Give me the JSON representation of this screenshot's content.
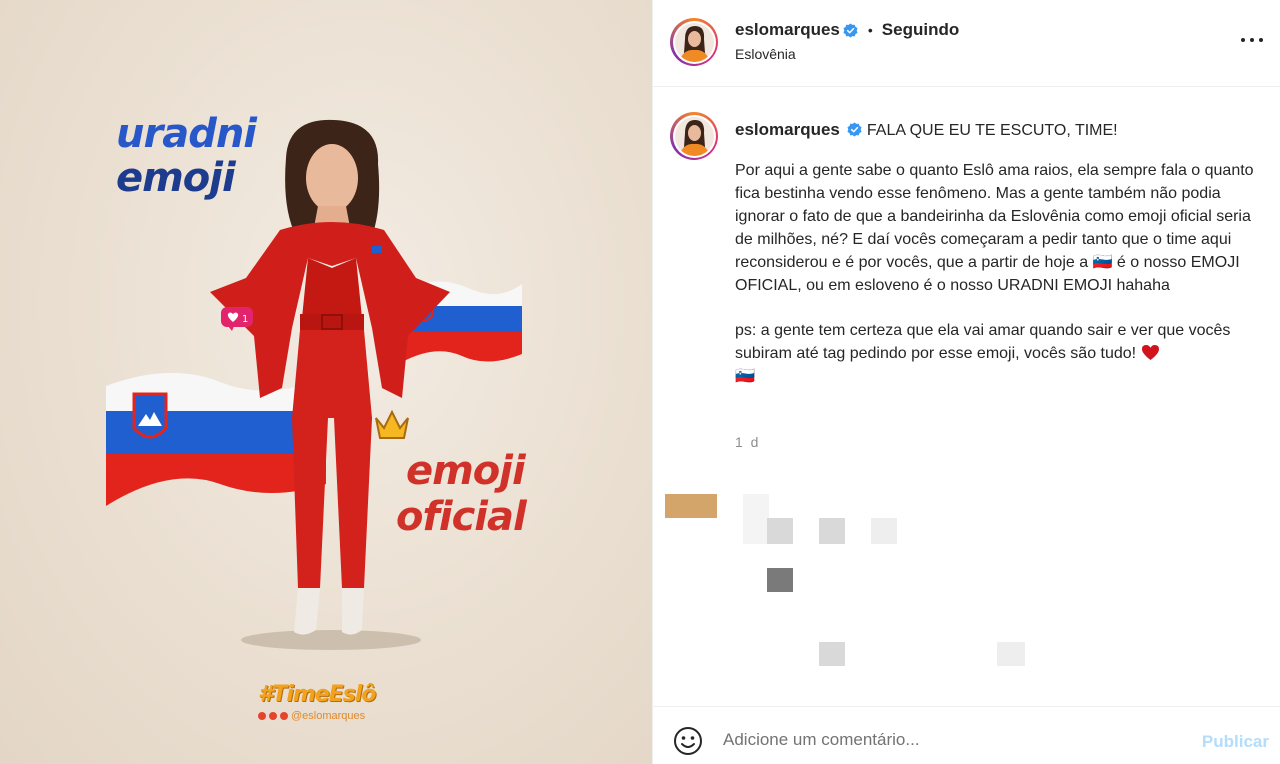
{
  "media": {
    "headline": [
      "uradni",
      "emoji"
    ],
    "official": [
      "emoji",
      "oficial"
    ],
    "hashtag": "#TimeEslô",
    "handle": "@eslomarques"
  },
  "header": {
    "username": "eslomarques",
    "separator": "•",
    "follow_label": "Seguindo",
    "location": "Eslovênia",
    "more_icon": "more-options-icon"
  },
  "caption": {
    "username": "eslomarques",
    "first_line": "FALA QUE EU TE ESCUTO, TIME!",
    "paragraph1": "Por aqui a gente sabe o quanto Eslô ama raios, ela sempre fala o quanto fica bestinha vendo esse fenômeno. Mas a gente também não podia ignorar o fato de que a bandeirinha da Eslovênia como emoji oficial seria de milhões, né? E daí vocês começaram a pedir tanto que o time aqui reconsiderou e é por vocês, que a partir de hoje a 🇸🇮 é o nosso EMOJI OFICIAL, ou em esloveno é o nosso URADNI EMOJI hahaha",
    "paragraph2": "ps: a gente tem certeza que ela vai amar quando sair e ver que vocês subiram até tag pedindo por esse emoji, vocês são tudo!",
    "trailing_flag": "🇸🇮",
    "timestamp": "1 d"
  },
  "comment_bar": {
    "placeholder": "Adicione um comentário...",
    "publish_label": "Publicar"
  },
  "colors": {
    "verified": "#3897f0",
    "publish_disabled": "#b4dcfb",
    "headline_blue": "#2757c9",
    "official_red": "#d0322a"
  }
}
